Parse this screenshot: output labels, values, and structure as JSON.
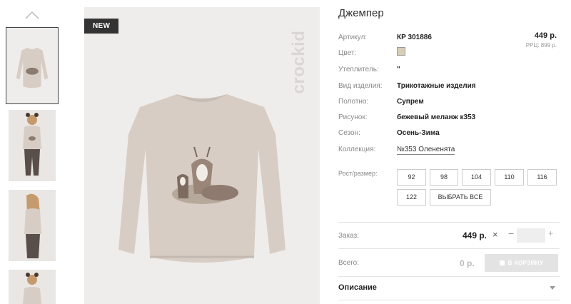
{
  "badge": "NEW",
  "brand": "crockid",
  "product": {
    "title": "Джемпер",
    "price": "449 р.",
    "rrc": "РРЦ: 899 р."
  },
  "attributes": [
    {
      "label": "Артикул:",
      "value": "КР 301886"
    },
    {
      "label": "Цвет:",
      "value": "",
      "swatch": "#d8cdb8"
    },
    {
      "label": "Утеплитель:",
      "value": "\""
    },
    {
      "label": "Вид изделия:",
      "value": "Трикотажные изделия"
    },
    {
      "label": "Полотно:",
      "value": "Супрем"
    },
    {
      "label": "Рисунок:",
      "value": "бежевый меланж к353"
    },
    {
      "label": "Сезон:",
      "value": "Осень-Зима"
    },
    {
      "label": "Коллекция:",
      "value": "№353 Олененята"
    }
  ],
  "sizes": {
    "label": "Рост/размер:",
    "options": [
      "92",
      "98",
      "104",
      "110",
      "116",
      "122"
    ],
    "select_all": "ВЫБРАТЬ ВСЕ"
  },
  "order": {
    "label": "Заказ:",
    "price": "449 р.",
    "times": "×",
    "minus": "−",
    "plus": "+",
    "qty": ""
  },
  "total": {
    "label": "Всего:",
    "value": "0 р.",
    "cart_button": "В КОРЗИНУ"
  },
  "description": {
    "label": "Описание"
  },
  "icons": {
    "thumb_up": "chevron-up-icon",
    "cart": "bag-icon",
    "expand": "chevron-down-icon"
  },
  "colors": {
    "badge_bg": "#333333",
    "sweater": "#d8cdc4",
    "cart_button_disabled": "#e3e3e3"
  }
}
